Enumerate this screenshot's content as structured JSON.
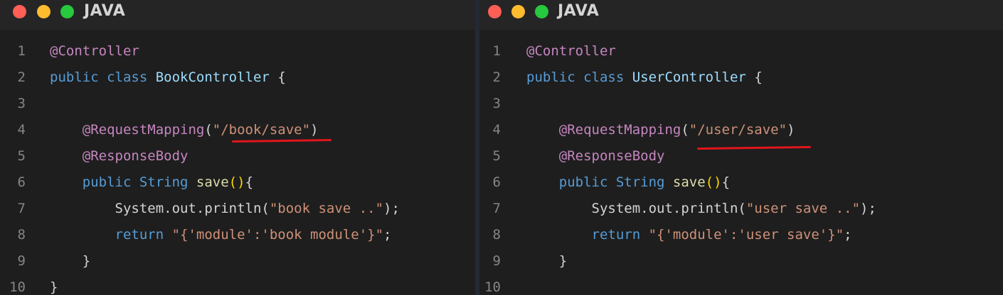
{
  "left_panel": {
    "title": "JAVA",
    "lines": [
      {
        "num": "1",
        "parts": [
          {
            "t": "@Controller",
            "c": "ann"
          }
        ]
      },
      {
        "num": "2",
        "parts": [
          {
            "t": "public class ",
            "c": "kw"
          },
          {
            "t": "BookController",
            "c": "cls"
          },
          {
            "t": " {",
            "c": "plain"
          }
        ]
      },
      {
        "num": "3",
        "parts": []
      },
      {
        "num": "4",
        "parts": [
          {
            "t": "    @RequestMapping",
            "c": "ann"
          },
          {
            "t": "(",
            "c": "plain"
          },
          {
            "t": "\"/book/save\"",
            "c": "str"
          },
          {
            "t": ")",
            "c": "plain"
          }
        ]
      },
      {
        "num": "5",
        "parts": [
          {
            "t": "    @ResponseBody",
            "c": "ann"
          }
        ]
      },
      {
        "num": "6",
        "parts": [
          {
            "t": "    public String ",
            "c": "kw"
          },
          {
            "t": "save",
            "c": "fn"
          },
          {
            "t": "()",
            "c": "paren"
          },
          {
            "t": "{",
            "c": "plain"
          }
        ]
      },
      {
        "num": "7",
        "parts": [
          {
            "t": "        System.out.println(",
            "c": "plain"
          },
          {
            "t": "\"book save ..\"",
            "c": "str"
          },
          {
            "t": ");",
            "c": "plain"
          }
        ]
      },
      {
        "num": "8",
        "parts": [
          {
            "t": "        return ",
            "c": "kw"
          },
          {
            "t": "\"{'module':'book module'}\"",
            "c": "str"
          },
          {
            "t": ";",
            "c": "plain"
          }
        ]
      },
      {
        "num": "9",
        "parts": [
          {
            "t": "    }",
            "c": "plain"
          }
        ]
      },
      {
        "num": "10",
        "parts": [
          {
            "t": "}",
            "c": "plain"
          }
        ]
      }
    ]
  },
  "right_panel": {
    "title": "JAVA",
    "lines": [
      {
        "num": "1",
        "parts": [
          {
            "t": "@Controller",
            "c": "ann"
          }
        ]
      },
      {
        "num": "2",
        "parts": [
          {
            "t": "public class ",
            "c": "kw"
          },
          {
            "t": "UserController",
            "c": "cls"
          },
          {
            "t": " {",
            "c": "plain"
          }
        ]
      },
      {
        "num": "3",
        "parts": []
      },
      {
        "num": "4",
        "parts": [
          {
            "t": "    @RequestMapping",
            "c": "ann"
          },
          {
            "t": "(",
            "c": "plain"
          },
          {
            "t": "\"/user/save\"",
            "c": "str"
          },
          {
            "t": ")",
            "c": "plain"
          }
        ]
      },
      {
        "num": "5",
        "parts": [
          {
            "t": "    @ResponseBody",
            "c": "ann"
          }
        ]
      },
      {
        "num": "6",
        "parts": [
          {
            "t": "    public String ",
            "c": "kw"
          },
          {
            "t": "save",
            "c": "fn"
          },
          {
            "t": "()",
            "c": "paren"
          },
          {
            "t": "{",
            "c": "plain"
          }
        ]
      },
      {
        "num": "7",
        "parts": [
          {
            "t": "        System.out.println(",
            "c": "plain"
          },
          {
            "t": "\"user save ..\"",
            "c": "str"
          },
          {
            "t": ");",
            "c": "plain"
          }
        ]
      },
      {
        "num": "8",
        "parts": [
          {
            "t": "        return ",
            "c": "kw"
          },
          {
            "t": "\"{'module':'user save'}\"",
            "c": "str"
          },
          {
            "t": ";",
            "c": "plain"
          }
        ]
      },
      {
        "num": "9",
        "parts": [
          {
            "t": "    }",
            "c": "plain"
          }
        ]
      },
      {
        "num": "10",
        "parts": []
      }
    ]
  },
  "colors": {
    "annotation": "#c586c0",
    "keyword": "#569cd6",
    "class_name": "#9cdcfe",
    "function": "#dcdcaa",
    "string": "#ce9178",
    "underline": "#e0161b"
  }
}
